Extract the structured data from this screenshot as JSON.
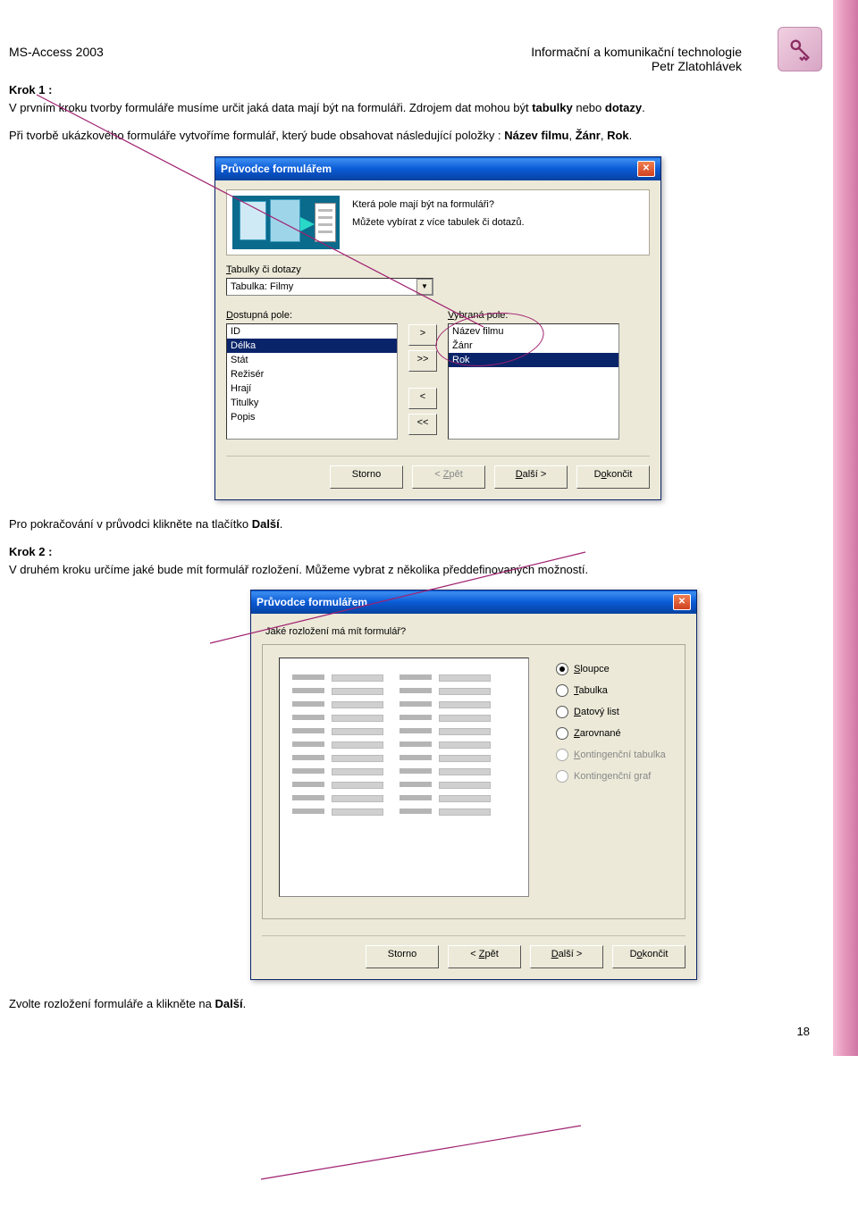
{
  "header": {
    "left": "MS-Access 2003",
    "right_line1": "Informační a komunikační technologie",
    "right_line2": "Petr Zlatohlávek"
  },
  "intro": {
    "krok1_label": "Krok 1 :",
    "krok1_p1a": "V prvním kroku tvorby formuláře musíme určit jaká data mají být na formuláři. Zdrojem dat mohou být ",
    "krok1_p1b_bold": "tabulky",
    "krok1_p1c": " nebo ",
    "krok1_p1d_bold": "dotazy",
    "krok1_p1e": ".",
    "krok1_p2a": "Při tvorbě ukázkového formuláře vytvoříme formulář, který bude obsahovat následující položky : ",
    "krok1_p2b_bold": "Název filmu",
    "krok1_p2c": ", ",
    "krok1_p2d_bold": "Žánr",
    "krok1_p2e": ", ",
    "krok1_p2f_bold": "Rok",
    "krok1_p2g": "."
  },
  "dialog1": {
    "title": "Průvodce formulářem",
    "banner_q": "Která pole mají být na formuláři?",
    "banner_hint": "Můžete vybírat z více tabulek či dotazů.",
    "tables_label_pre": "T",
    "tables_label_rest": "abulky či dotazy",
    "combo_value": "Tabulka: Filmy",
    "avail_label_pre": "D",
    "avail_label_rest": "ostupná pole:",
    "selected_label_pre": "V",
    "selected_label_rest": "ybraná pole:",
    "available_fields": [
      "ID",
      "Délka",
      "Stát",
      "Režisér",
      "Hrají",
      "Titulky",
      "Popis"
    ],
    "available_selected_index": 1,
    "selected_fields": [
      "Název filmu",
      "Žánr",
      "Rok"
    ],
    "selected_selected_index": 2,
    "btn_add": ">",
    "btn_add_all": ">>",
    "btn_remove": "<",
    "btn_remove_all": "<<",
    "btn_cancel": "Storno",
    "btn_back": "< Zpět",
    "btn_next": "Další >",
    "btn_finish": "Dokončit",
    "btn_back_underline": "Z",
    "btn_next_underline": "D",
    "btn_finish_underline": "o"
  },
  "mid_text": {
    "p1a": "Pro pokračování v průvodci klikněte na tlačítko ",
    "p1b_bold": "Další",
    "p1c": ".",
    "krok2_label": "Krok 2 :",
    "p2": "V druhém kroku určíme jaké bude mít formulář rozložení. Můžeme vybrat z několika předdefinovaných možností."
  },
  "dialog2": {
    "title": "Průvodce formulářem",
    "question": "Jaké rozložení má mít formulář?",
    "radios": [
      {
        "label_pre": "S",
        "label_rest": "loupce",
        "checked": true,
        "disabled": false
      },
      {
        "label_pre": "T",
        "label_rest": "abulka",
        "checked": false,
        "disabled": false
      },
      {
        "label_pre": "D",
        "label_rest": "atový list",
        "checked": false,
        "disabled": false
      },
      {
        "label_pre": "Z",
        "label_rest": "arovnané",
        "checked": false,
        "disabled": false
      },
      {
        "label_pre": "K",
        "label_rest": "ontingenční tabulka",
        "checked": false,
        "disabled": true
      },
      {
        "label_pre": "",
        "label_rest": "Kontingenční graf",
        "checked": false,
        "disabled": true,
        "underline_char": "g"
      }
    ],
    "btn_cancel": "Storno",
    "btn_back": "< Zpět",
    "btn_next": "Další >",
    "btn_finish": "Dokončit"
  },
  "footer": {
    "line_a": "Zvolte rozložení formuláře a klikněte na ",
    "line_b_bold": "Další",
    "line_c": ".",
    "page_number": "18"
  }
}
